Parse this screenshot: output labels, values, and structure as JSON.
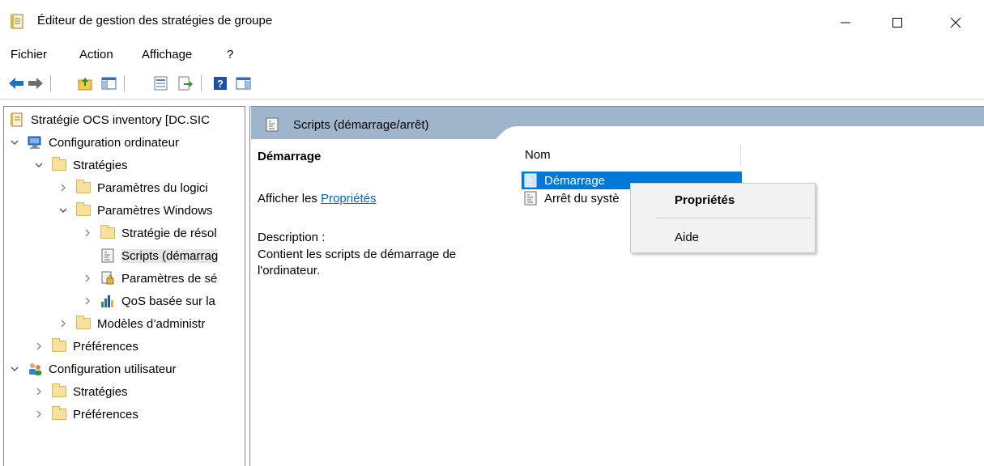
{
  "window": {
    "title": "Éditeur de gestion des stratégies de groupe",
    "app_icon": "policy-doc-icon",
    "controls": {
      "minimize": "minimize-icon",
      "maximize": "maximize-icon",
      "close": "close-icon"
    }
  },
  "menu": {
    "items": [
      "Fichier",
      "Action",
      "Affichage",
      "?"
    ]
  },
  "toolbar": {
    "buttons": [
      "back-arrow-icon",
      "forward-arrow-icon",
      "up-folder-icon",
      "show-hide-tree-icon",
      "properties-icon",
      "export-list-icon",
      "help-icon",
      "action-pane-icon"
    ]
  },
  "tree": {
    "root": "Stratégie OCS inventory [DC.SIC",
    "items": [
      {
        "label": "Configuration ordinateur",
        "icon": "computer-icon",
        "expanded": true
      },
      {
        "label": "Stratégies",
        "icon": "folder-icon",
        "expanded": true
      },
      {
        "label": "Paramètres du logici",
        "icon": "folder-icon",
        "expanded": false
      },
      {
        "label": "Paramètres Windows",
        "icon": "folder-icon",
        "expanded": true
      },
      {
        "label": "Stratégie de résol",
        "icon": "folder-icon",
        "expanded": false
      },
      {
        "label": "Scripts (démarrag",
        "icon": "script-icon",
        "selected": true
      },
      {
        "label": "Paramètres de sé",
        "icon": "security-settings-icon",
        "expanded": false
      },
      {
        "label": "QoS basée sur la",
        "icon": "qos-chart-icon",
        "expanded": false
      },
      {
        "label": "Modèles d’administr",
        "icon": "folder-icon",
        "expanded": false
      },
      {
        "label": "Préférences",
        "icon": "folder-icon",
        "expanded": false
      },
      {
        "label": "Configuration utilisateur",
        "icon": "users-icon",
        "expanded": true
      },
      {
        "label": "Stratégies",
        "icon": "folder-icon",
        "expanded": false
      },
      {
        "label": "Préférences",
        "icon": "folder-icon",
        "expanded": false
      }
    ]
  },
  "details": {
    "header_title": "Scripts (démarrage/arrêt)",
    "extended": {
      "title": "Démarrage",
      "show_prefix": "Afficher les ",
      "show_link": "Propriétés",
      "description_label": "Description :",
      "description_text": "Contient les scripts de démarrage de l'ordinateur."
    },
    "column_name": "Nom",
    "rows": [
      {
        "label": "Démarrage",
        "icon": "startup-script-icon",
        "selected": true
      },
      {
        "label": "Arrêt du systè",
        "icon": "shutdown-script-icon",
        "selected": false
      }
    ]
  },
  "context_menu": {
    "items": [
      {
        "label": "Propriétés",
        "bold": true
      },
      {
        "label": "Aide",
        "bold": false
      }
    ]
  },
  "colors": {
    "header_band": "#9fb5cb",
    "selection": "#0078d7",
    "link": "#0066cc"
  }
}
